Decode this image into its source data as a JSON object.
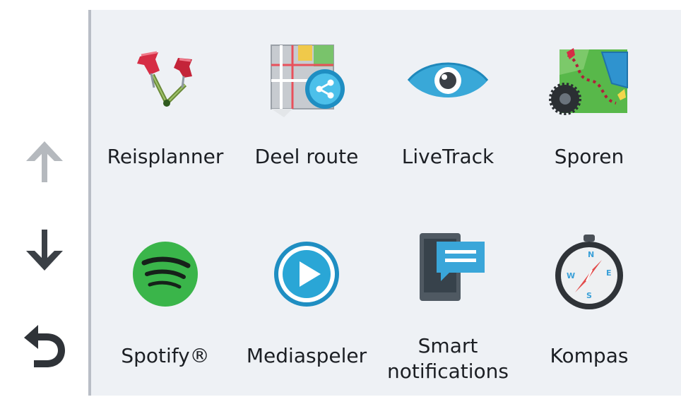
{
  "navigation": {
    "up_icon": "arrow-up-icon",
    "down_icon": "arrow-down-icon",
    "back_icon": "back-arrow-icon",
    "colors": {
      "up_disabled": "#b5b9be",
      "down": "#3b4046",
      "back": "#2f3338"
    }
  },
  "apps": [
    {
      "label": "Reisplanner",
      "icon": "trip-planner-pins-icon"
    },
    {
      "label": "Deel route",
      "icon": "share-route-map-icon"
    },
    {
      "label": "LiveTrack",
      "icon": "eye-icon"
    },
    {
      "label": "Sporen",
      "icon": "tracks-map-icon"
    },
    {
      "label": "Spotify®",
      "icon": "spotify-icon"
    },
    {
      "label": "Mediaspeler",
      "icon": "media-player-icon"
    },
    {
      "label": "Smart notifications",
      "label_line1": "Smart",
      "label_line2": "notifications",
      "icon": "smart-notifications-icon"
    },
    {
      "label": "Kompas",
      "icon": "compass-icon"
    }
  ],
  "colors": {
    "background": "#eef1f5",
    "sidebar": "#ffffff",
    "divider": "#b9bec6",
    "text": "#1c1f24",
    "spotify_green": "#3ab54a",
    "media_blue": "#2aa6d6",
    "eye_blue": "#39a8d8",
    "pin_red": "#d62d45"
  }
}
